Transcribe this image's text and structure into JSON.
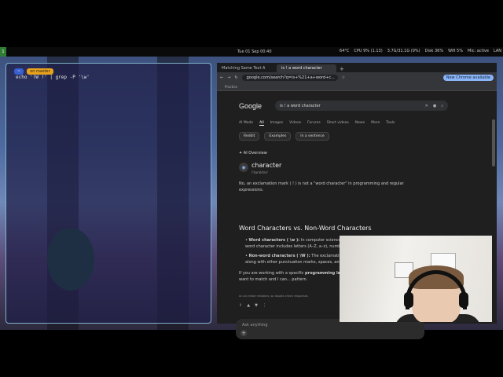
{
  "topbar": {
    "workspace": "1",
    "clock": "Tue 01 Sep 00:40",
    "tray": [
      "64°C",
      "CPU 9% (1.13)",
      "3.7G/31.1G (9%)",
      "Disk 36%",
      "Wifi 5%",
      "Mic: active",
      "LAN"
    ]
  },
  "terminal": {
    "prompt_dir": "~",
    "prompt_branch": "on master",
    "command": "echo '!W !' | grep -P '\\w'"
  },
  "browser": {
    "tabs": [
      {
        "label": "Matching Same Text A"
      },
      {
        "label": "is ! a word character"
      }
    ],
    "url": "google.com/search?q=is+%21+a+word+c...",
    "new_chrome": "New Chrome available",
    "bookmarks": [
      "Practice"
    ]
  },
  "google": {
    "logo": "Google",
    "query": "is ! a word character",
    "tabs": [
      "AI Mode",
      "All",
      "Images",
      "Videos",
      "Forums",
      "Short videos",
      "News",
      "More",
      "Tools"
    ],
    "chips": [
      "Reddit",
      "Examples",
      "In a sentence"
    ],
    "ai_overview_label": "AI Overview",
    "word": "character",
    "word_sub": "/ˈkarəktər/",
    "intro": "No, an exclamation mark ( ! ) is not a \"word character\" in programming and regular expressions.",
    "section_title": "Word Characters vs. Non-Word Characters",
    "bullet1_bold": "Word characters ( \\w ):",
    "bullet1": " In computer science and regular expressions (regex), a word character includes letters (A–Z, a–z), numbers (0–9), and the underscore ( _ ).",
    "bullet2_bold": "Non-word characters ( \\W ):",
    "bullet2": " The exclamation mark falls into this category, along with other punctuation marks, spaces, and symbols like ? , @ , and # .",
    "para_start": "If you are working with a specific ",
    "para_bold": "programming lang... expression",
    "para_end": ", tell me what you want to match and I can... pattern.",
    "note": "AI can make mistakes, so double-check responses",
    "ask_placeholder": "Ask anything"
  }
}
